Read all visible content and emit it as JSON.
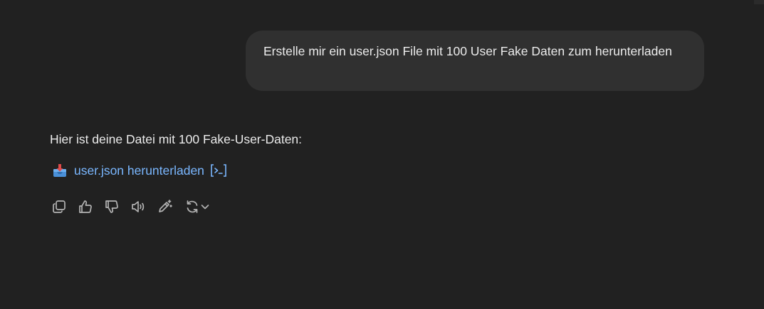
{
  "conversation": {
    "user_message": "Erstelle mir ein user.json File mit 100 User Fake Daten zum herunterladen",
    "assistant": {
      "intro": "Hier ist deine Datei mit 100 Fake-User-Daten:",
      "download_link": "user.json herunterladen",
      "download_icon": "inbox-tray-icon",
      "code_icon": "code-interpreter-icon"
    }
  },
  "actions": [
    {
      "name": "copy",
      "icon": "copy-icon"
    },
    {
      "name": "thumbs-up",
      "icon": "thumbs-up-icon"
    },
    {
      "name": "thumbs-down",
      "icon": "thumbs-down-icon"
    },
    {
      "name": "read-aloud",
      "icon": "speaker-icon"
    },
    {
      "name": "edit-canvas",
      "icon": "pencil-sparkle-icon"
    },
    {
      "name": "regenerate",
      "icon": "refresh-icon"
    }
  ],
  "colors": {
    "background": "#212121",
    "user_bubble": "#303030",
    "text": "#ececec",
    "link": "#7ab7ff",
    "icon": "#b4b4b4"
  }
}
